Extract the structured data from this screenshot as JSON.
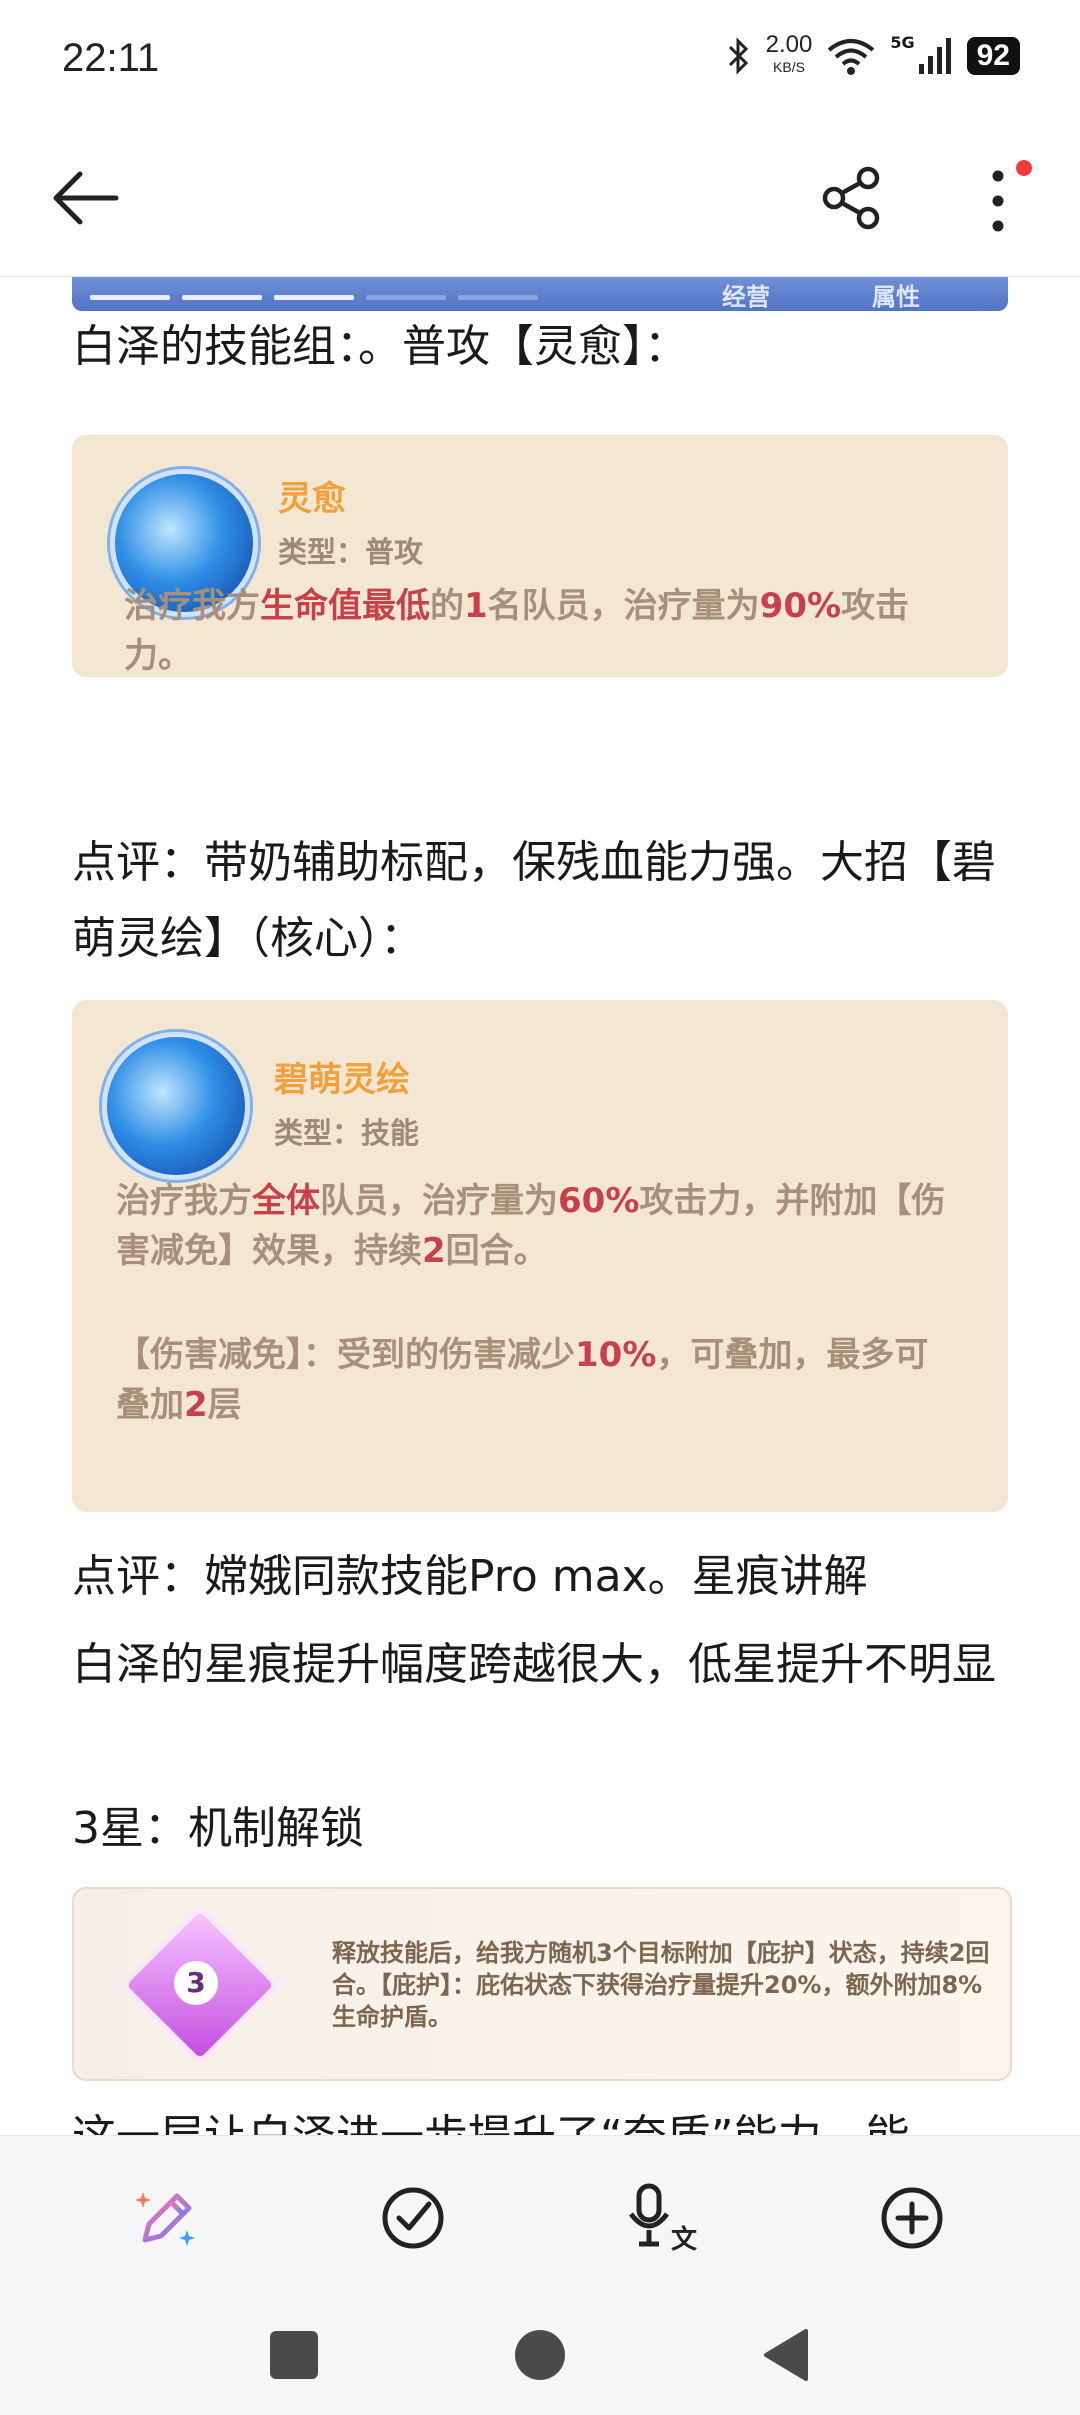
{
  "status_bar": {
    "time": "22:11",
    "net_speed_value": "2.00",
    "net_speed_unit": "KB/S",
    "network_type": "5G",
    "battery": "92"
  },
  "banner": {
    "label_left": "经营",
    "label_right": "属性"
  },
  "article": {
    "p1": "白泽的技能组：。普攻【灵愈】：",
    "skill1": {
      "name": "灵愈",
      "type": "类型：普攻",
      "desc_a": "治疗我方",
      "desc_hl1": "生命值最低",
      "desc_b": "的",
      "desc_hl2": "1",
      "desc_c": "名队员，治疗量为",
      "desc_hl3": "90%",
      "desc_d": "攻击力。"
    },
    "p2": "点评：带奶辅助标配，保残血能力强。大招【碧萌灵绘】（核心）：",
    "skill2": {
      "name": "碧萌灵绘",
      "type": "类型：技能",
      "desc_a": "治疗我方",
      "desc_hl1": "全体",
      "desc_b": "队员，治疗量为",
      "desc_hl2": "60%",
      "desc_c": "攻击力，并附加【伤害减免】效果，持续",
      "desc_hl3": "2",
      "desc_d": "回合。",
      "desc2_a": "【伤害减免】：受到的伤害减少",
      "desc2_hl1": "10%",
      "desc2_b": "，可叠加，最多可叠加",
      "desc2_hl2": "2",
      "desc2_c": "层"
    },
    "p3": "点评：嫦娥同款技能Pro max。星痕讲解",
    "p4": "白泽的星痕提升幅度跨越很大，低星提升不明显",
    "p5": "3星：机制解锁",
    "star3": {
      "badge": "3",
      "desc": "释放技能后，给我方随机3个目标附加【庇护】状态，持续2回合。【庇护】：庇佑状态下获得治疗量提升20%，额外附加8%生命护盾。"
    },
    "p6": "这一层让白泽进一步提升了“奈质”能力，能"
  },
  "toolbar": {
    "icons": [
      "ai-pen-icon",
      "check-circle-icon",
      "voice-translate-icon",
      "add-circle-icon"
    ]
  },
  "colors": {
    "accent_red": "#c8404a",
    "skill_name": "#f2a03c",
    "card_bg": "#f3e7d4"
  }
}
